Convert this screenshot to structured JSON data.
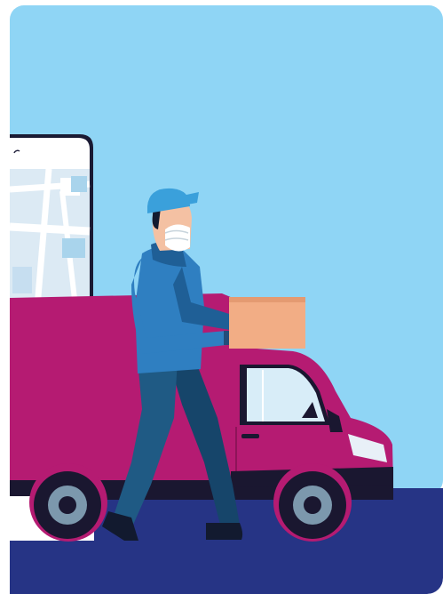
{
  "illustration": {
    "subject": "delivery",
    "icons": [
      "phone-map-icon",
      "delivery-van-icon",
      "courier-icon",
      "parcel-box-icon",
      "face-mask-icon",
      "cap-icon"
    ]
  },
  "colors": {
    "sky": "#8fd5f5",
    "road": "#263485",
    "van_body": "#b51b72",
    "van_dark": "#1a1730",
    "wheel_hub": "#7c98ad",
    "window_glass": "#d8edf8",
    "phone_screen": "#dceaf4",
    "map_block": "#a9d4ec",
    "hoodie": "#2f7fc1",
    "hoodie_shadow": "#1f5f96",
    "jeans": "#1f5a84",
    "jeans_dark": "#16456a",
    "cap": "#3aa0db",
    "skin": "#f4c1a3",
    "box": "#f2ad85",
    "box_shade": "#e49a71",
    "glove": "#234d7a",
    "shoe": "#121a2f"
  }
}
